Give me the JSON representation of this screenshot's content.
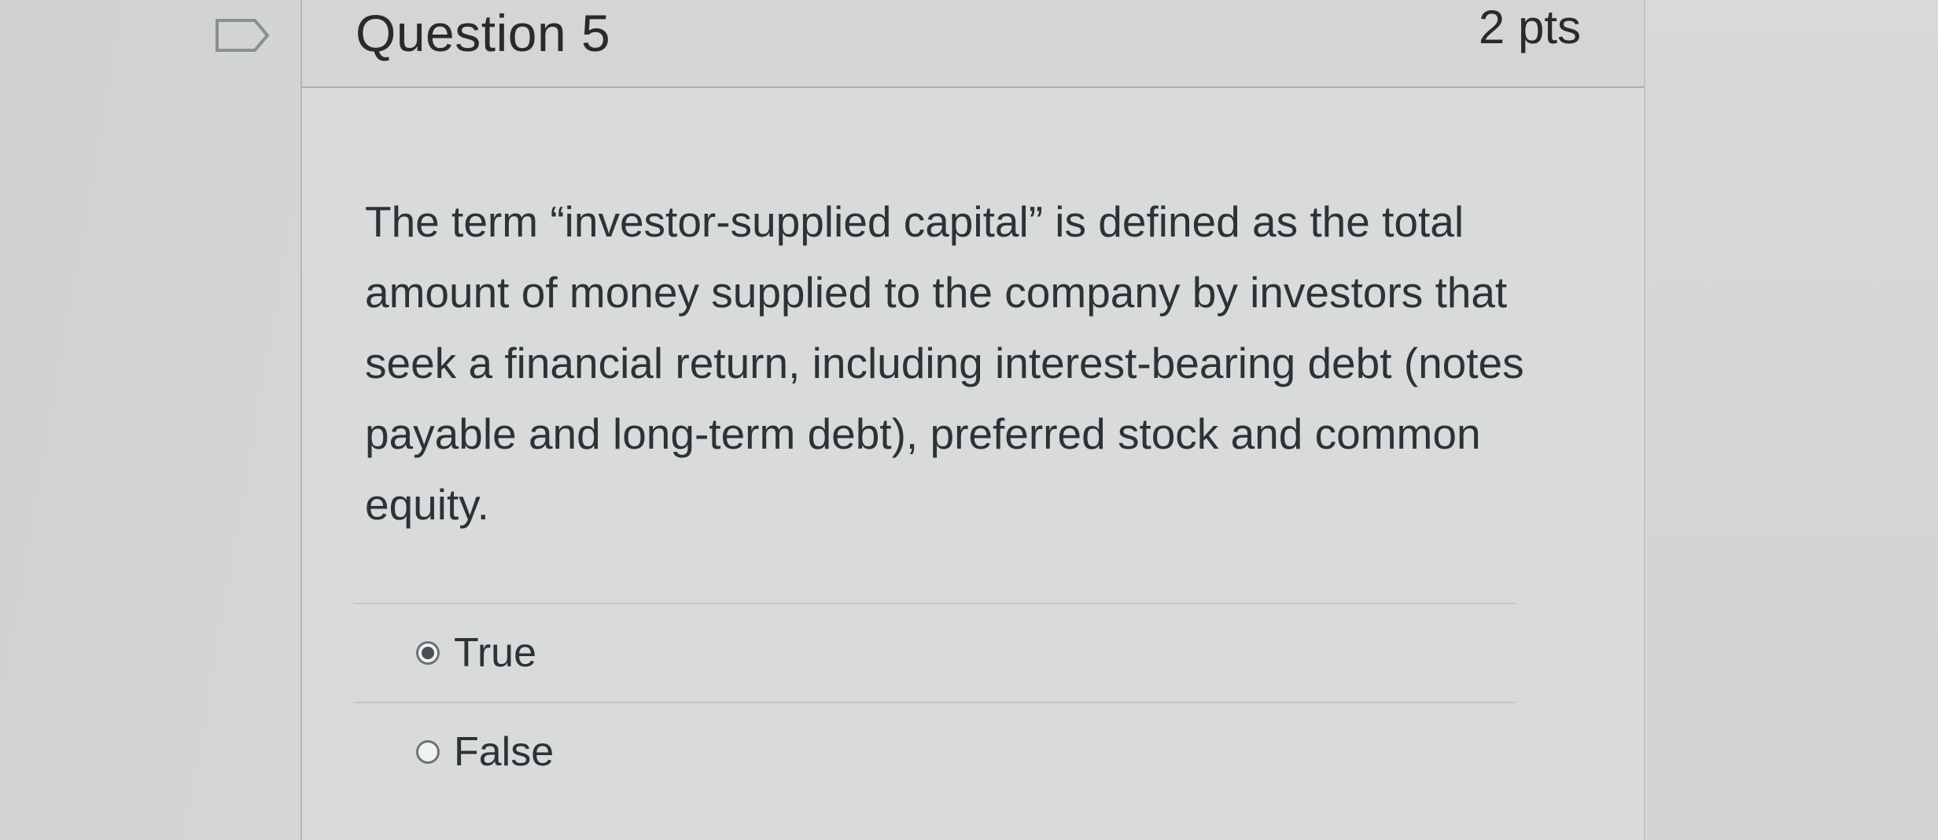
{
  "question": {
    "title": "Question 5",
    "points": "2 pts",
    "text": "The term “investor-supplied capital” is defined as the total amount of money supplied to the company by investors that seek a financial return, including interest-bearing debt (notes payable and long-term debt), preferred stock and common equity.",
    "answers": [
      {
        "label": "True",
        "selected": true
      },
      {
        "label": "False",
        "selected": false
      }
    ]
  },
  "icons": {
    "bookmark": "bookmark-flag-icon",
    "selected_radio": "radio-checked-icon",
    "unselected_radio": "radio-unchecked-icon"
  },
  "colors": {
    "text": "#2c3338",
    "header_bg": "#d4d5d5",
    "body_bg": "#d9dada"
  }
}
